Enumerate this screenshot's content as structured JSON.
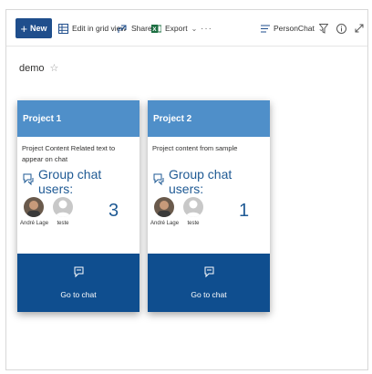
{
  "toolbar": {
    "new_label": "New",
    "edit_grid_label": "Edit in grid view",
    "share_label": "Share",
    "export_label": "Export",
    "more_label": "···",
    "view_label": "PersonChat"
  },
  "page": {
    "title": "demo"
  },
  "cards": [
    {
      "title": "Project 1",
      "description": "Project Content Related text to appear on chat",
      "group_label": "Group chat users:",
      "users": [
        {
          "name": "André Lage"
        },
        {
          "name": "teste"
        }
      ],
      "count": "3",
      "action_label": "Go to chat"
    },
    {
      "title": "Project 2",
      "description": "Project content from sample",
      "group_label": "Group chat users:",
      "users": [
        {
          "name": "André Lage"
        },
        {
          "name": "teste"
        }
      ],
      "count": "1",
      "action_label": "Go to chat"
    }
  ],
  "colors": {
    "primary": "#1f4e8c",
    "card_header": "#4f8fc9",
    "card_footer": "#0f4e8f",
    "accent_text": "#1f5a94"
  },
  "icons": {
    "new": "plus-icon",
    "edit_grid": "grid-icon",
    "share": "share-icon",
    "export": "excel-icon",
    "view": "view-lines-icon",
    "filter": "filter-icon",
    "info": "info-icon",
    "expand": "expand-icon",
    "favorite": "star-icon",
    "group": "group-chat-icon",
    "chat": "chat-icon"
  }
}
